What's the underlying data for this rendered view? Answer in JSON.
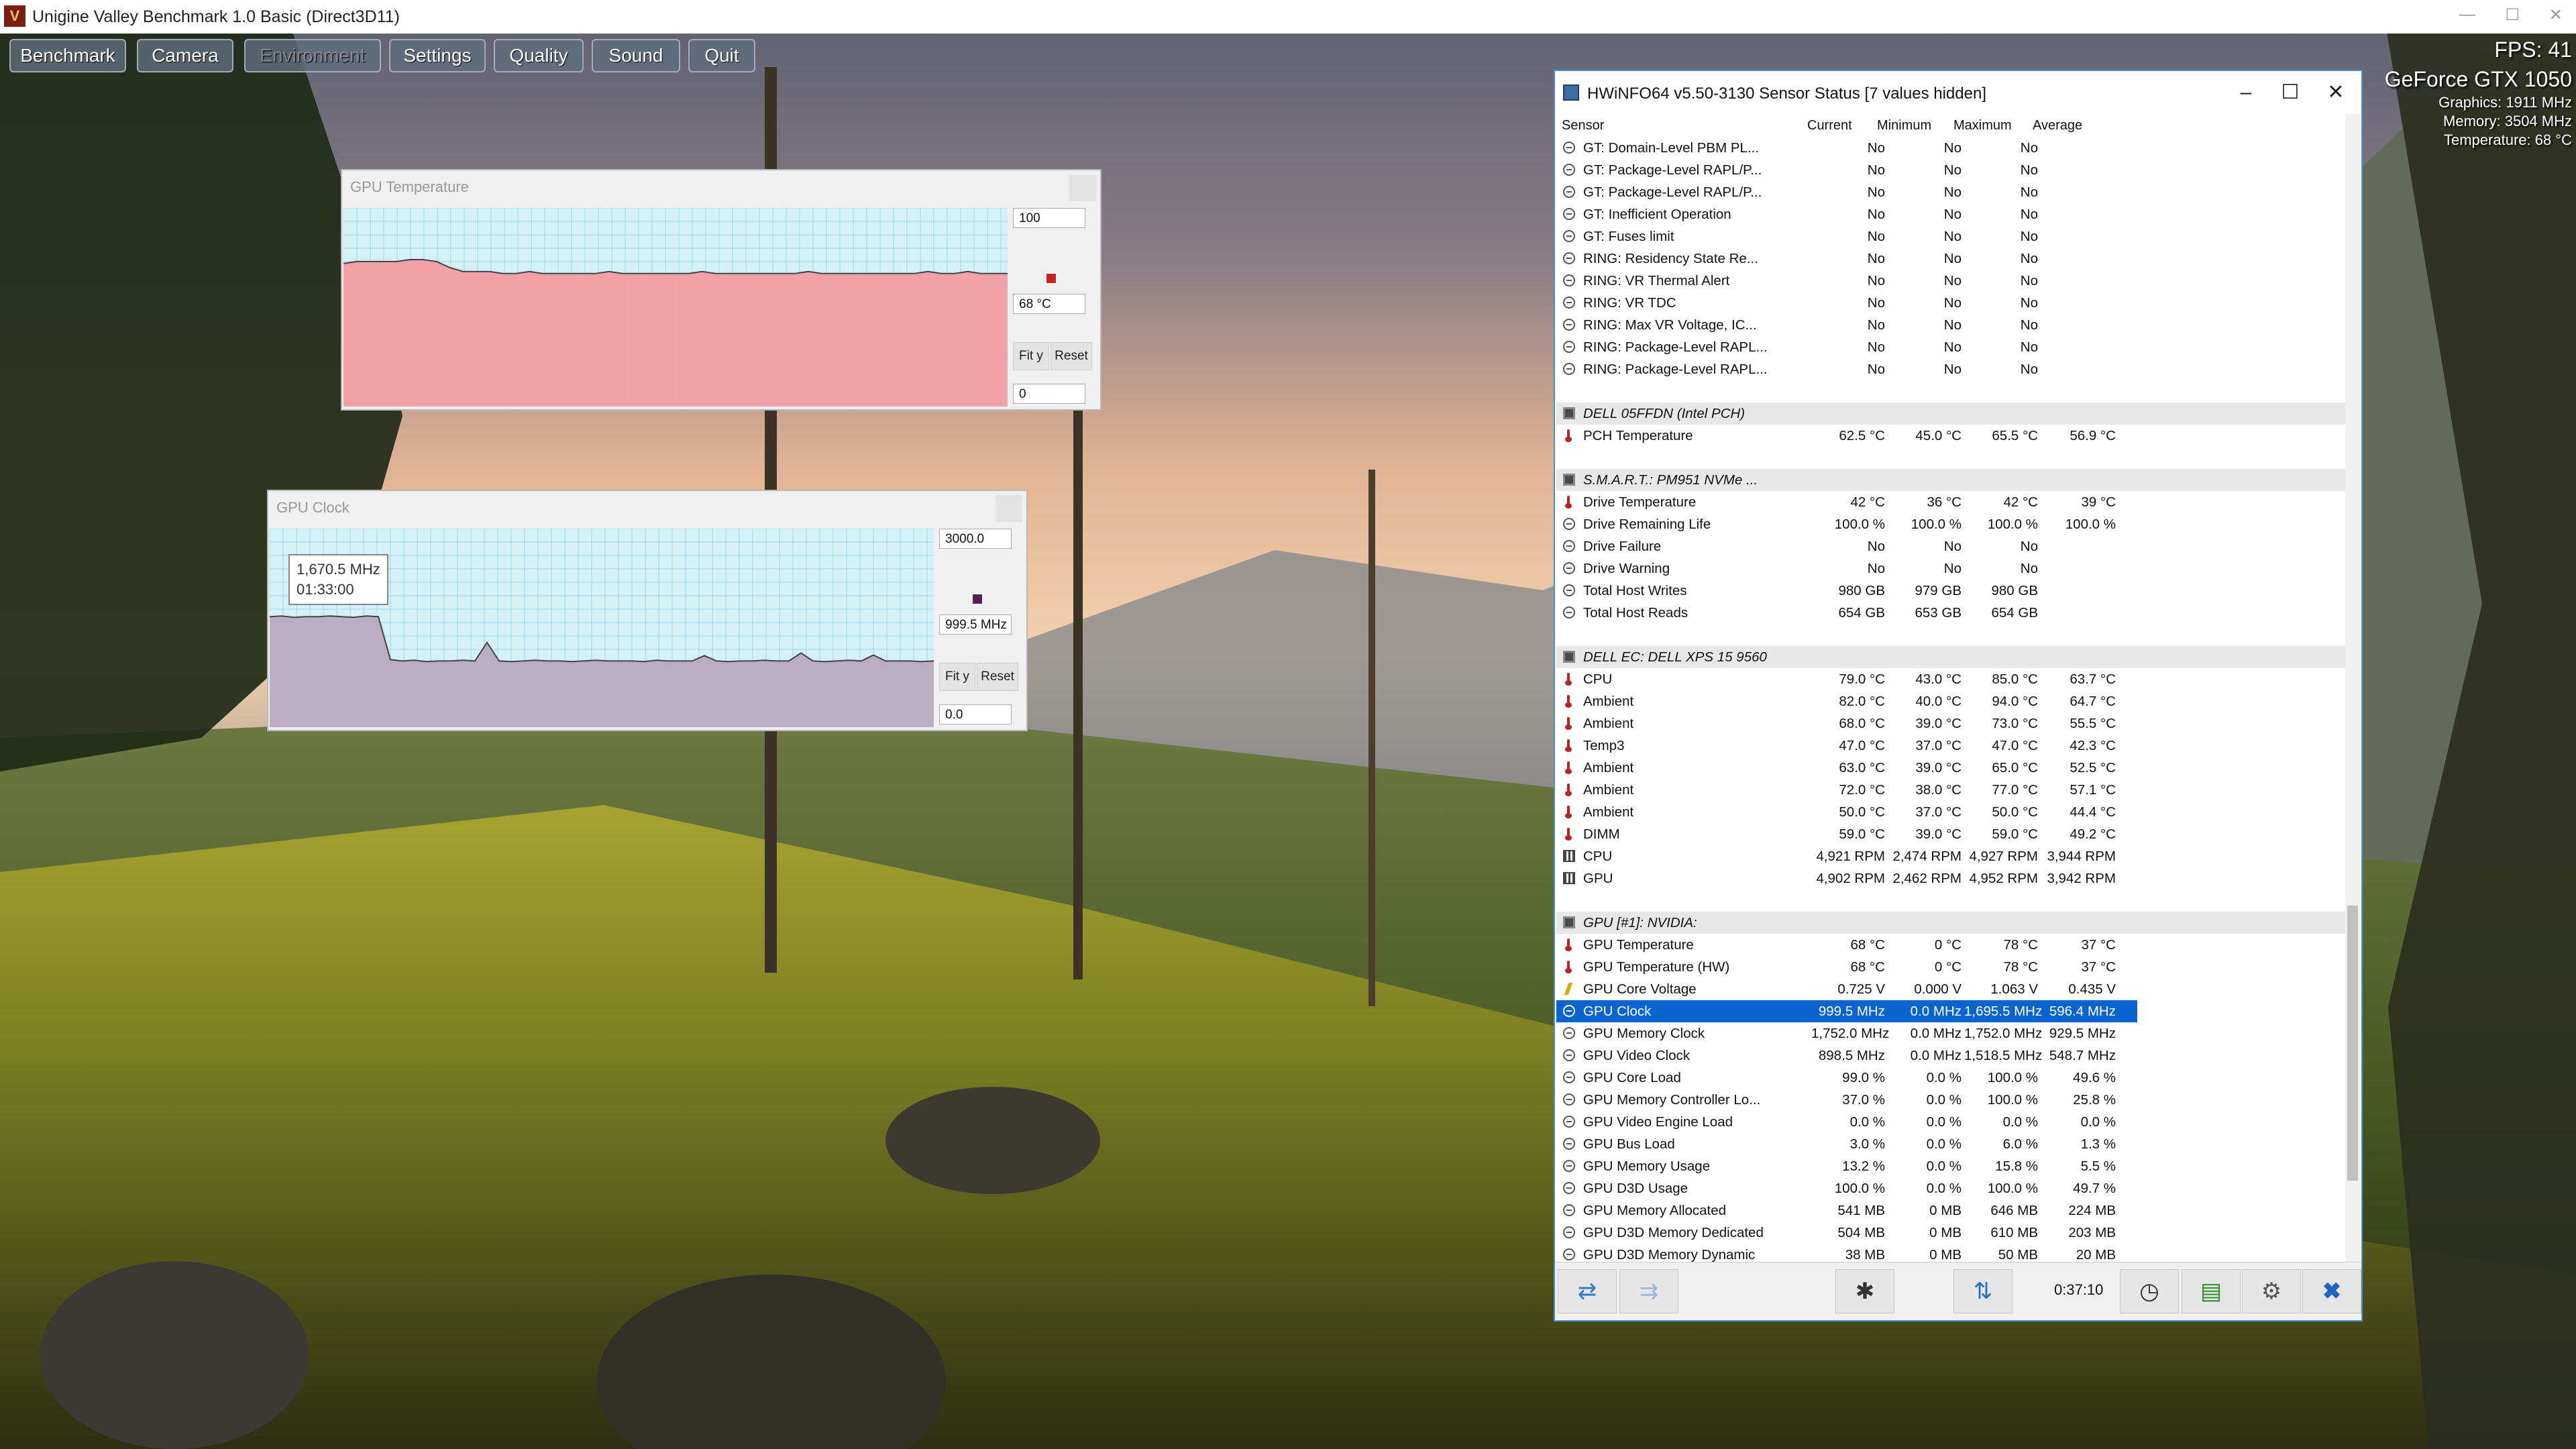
{
  "app": {
    "title": "Unigine Valley Benchmark 1.0 Basic (Direct3D11)",
    "menu": [
      {
        "label": "Benchmark",
        "disabled": false
      },
      {
        "label": "Camera",
        "disabled": false
      },
      {
        "label": "Environment",
        "disabled": true
      },
      {
        "label": "Settings",
        "disabled": false
      },
      {
        "label": "Quality",
        "disabled": false
      },
      {
        "label": "Sound",
        "disabled": false
      },
      {
        "label": "Quit",
        "disabled": false
      }
    ],
    "overlay": {
      "fps": "FPS: 41",
      "gpu": "GeForce GTX 1050",
      "graphics": "Graphics: 1911 MHz",
      "memory": "Memory: 3504 MHz",
      "temperature": "Temperature: 68 °C"
    }
  },
  "temp_graph": {
    "title": "GPU Temperature",
    "max": "100",
    "current": "68 °C",
    "min": "0",
    "fit_label": "Fit y",
    "reset_label": "Reset",
    "color": "#f49aa0",
    "range": [
      0,
      100
    ],
    "values": [
      72,
      73,
      73,
      73,
      73,
      74,
      74,
      73,
      70,
      68,
      68,
      68,
      67,
      67,
      68,
      67,
      67,
      67,
      67,
      67,
      68,
      67,
      67,
      67,
      67,
      67,
      67,
      68,
      67,
      67,
      67,
      67,
      67,
      67,
      67,
      68,
      67,
      67,
      67,
      67,
      67,
      67,
      67,
      67,
      68,
      67,
      67,
      68,
      67,
      67,
      67
    ]
  },
  "clock_graph": {
    "title": "GPU Clock",
    "max": "3000.0",
    "current": "999.5 MHz",
    "min": "0.0",
    "fit_label": "Fit y",
    "reset_label": "Reset",
    "color": "#b7a9bc",
    "range": [
      0,
      3000
    ],
    "tooltip_value": "1,670.5 MHz",
    "tooltip_time": "01:33:00",
    "values": [
      1670,
      1680,
      1660,
      1670,
      1670,
      1680,
      1670,
      1660,
      1680,
      1670,
      1020,
      1000,
      1010,
      990,
      1000,
      1000,
      1010,
      1000,
      1280,
      1000,
      990,
      1000,
      1010,
      1000,
      1000,
      990,
      1000,
      1010,
      1000,
      1000,
      1000,
      990,
      1010,
      1000,
      1000,
      1000,
      1080,
      1000,
      990,
      1000,
      1000,
      1010,
      1000,
      1000,
      1120,
      1000,
      990,
      1000,
      1010,
      1000,
      1090,
      1000,
      1000,
      1000,
      990,
      1000
    ]
  },
  "hwinfo": {
    "title": "HWiNFO64 v5.50-3130 Sensor Status [7 values hidden]",
    "columns": [
      "Sensor",
      "Current",
      "Minimum",
      "Maximum",
      "Average"
    ],
    "rows": [
      {
        "icon": "clock",
        "name": "GT: Domain-Level PBM PL...",
        "cur": "No",
        "min": "No",
        "max": "No",
        "avg": ""
      },
      {
        "icon": "clock",
        "name": "GT: Package-Level RAPL/P...",
        "cur": "No",
        "min": "No",
        "max": "No",
        "avg": ""
      },
      {
        "icon": "clock",
        "name": "GT: Package-Level RAPL/P...",
        "cur": "No",
        "min": "No",
        "max": "No",
        "avg": ""
      },
      {
        "icon": "clock",
        "name": "GT: Inefficient Operation",
        "cur": "No",
        "min": "No",
        "max": "No",
        "avg": ""
      },
      {
        "icon": "clock",
        "name": "GT: Fuses limit",
        "cur": "No",
        "min": "No",
        "max": "No",
        "avg": ""
      },
      {
        "icon": "clock",
        "name": "RING: Residency State Re...",
        "cur": "No",
        "min": "No",
        "max": "No",
        "avg": ""
      },
      {
        "icon": "clock",
        "name": "RING: VR Thermal Alert",
        "cur": "No",
        "min": "No",
        "max": "No",
        "avg": ""
      },
      {
        "icon": "clock",
        "name": "RING: VR TDC",
        "cur": "No",
        "min": "No",
        "max": "No",
        "avg": ""
      },
      {
        "icon": "clock",
        "name": "RING: Max VR Voltage, IC...",
        "cur": "No",
        "min": "No",
        "max": "No",
        "avg": ""
      },
      {
        "icon": "clock",
        "name": "RING: Package-Level RAPL...",
        "cur": "No",
        "min": "No",
        "max": "No",
        "avg": ""
      },
      {
        "icon": "clock",
        "name": "RING: Package-Level RAPL...",
        "cur": "No",
        "min": "No",
        "max": "No",
        "avg": ""
      },
      {
        "type": "blank"
      },
      {
        "type": "group",
        "name": "DELL 05FFDN (Intel PCH)"
      },
      {
        "icon": "therm",
        "name": "PCH Temperature",
        "cur": "62.5 °C",
        "min": "45.0 °C",
        "max": "65.5 °C",
        "avg": "56.9 °C"
      },
      {
        "type": "blank"
      },
      {
        "type": "group",
        "name": "S.M.A.R.T.: PM951 NVMe ..."
      },
      {
        "icon": "therm",
        "name": "Drive Temperature",
        "cur": "42 °C",
        "min": "36 °C",
        "max": "42 °C",
        "avg": "39 °C"
      },
      {
        "icon": "clock",
        "name": "Drive Remaining Life",
        "cur": "100.0 %",
        "min": "100.0 %",
        "max": "100.0 %",
        "avg": "100.0 %"
      },
      {
        "icon": "clock",
        "name": "Drive Failure",
        "cur": "No",
        "min": "No",
        "max": "No",
        "avg": ""
      },
      {
        "icon": "clock",
        "name": "Drive Warning",
        "cur": "No",
        "min": "No",
        "max": "No",
        "avg": ""
      },
      {
        "icon": "clock",
        "name": "Total Host Writes",
        "cur": "980 GB",
        "min": "979 GB",
        "max": "980 GB",
        "avg": ""
      },
      {
        "icon": "clock",
        "name": "Total Host Reads",
        "cur": "654 GB",
        "min": "653 GB",
        "max": "654 GB",
        "avg": ""
      },
      {
        "type": "blank"
      },
      {
        "type": "group",
        "name": "DELL EC: DELL XPS 15 9560"
      },
      {
        "icon": "therm",
        "name": "CPU",
        "cur": "79.0 °C",
        "min": "43.0 °C",
        "max": "85.0 °C",
        "avg": "63.7 °C"
      },
      {
        "icon": "therm",
        "name": "Ambient",
        "cur": "82.0 °C",
        "min": "40.0 °C",
        "max": "94.0 °C",
        "avg": "64.7 °C"
      },
      {
        "icon": "therm",
        "name": "Ambient",
        "cur": "68.0 °C",
        "min": "39.0 °C",
        "max": "73.0 °C",
        "avg": "55.5 °C"
      },
      {
        "icon": "therm",
        "name": "Temp3",
        "cur": "47.0 °C",
        "min": "37.0 °C",
        "max": "47.0 °C",
        "avg": "42.3 °C"
      },
      {
        "icon": "therm",
        "name": "Ambient",
        "cur": "63.0 °C",
        "min": "39.0 °C",
        "max": "65.0 °C",
        "avg": "52.5 °C"
      },
      {
        "icon": "therm",
        "name": "Ambient",
        "cur": "72.0 °C",
        "min": "38.0 °C",
        "max": "77.0 °C",
        "avg": "57.1 °C"
      },
      {
        "icon": "therm",
        "name": "Ambient",
        "cur": "50.0 °C",
        "min": "37.0 °C",
        "max": "50.0 °C",
        "avg": "44.4 °C"
      },
      {
        "icon": "therm",
        "name": "DIMM",
        "cur": "59.0 °C",
        "min": "39.0 °C",
        "max": "59.0 °C",
        "avg": "49.2 °C"
      },
      {
        "icon": "fan",
        "name": "CPU",
        "cur": "4,921 RPM",
        "min": "2,474 RPM",
        "max": "4,927 RPM",
        "avg": "3,944 RPM"
      },
      {
        "icon": "fan",
        "name": "GPU",
        "cur": "4,902 RPM",
        "min": "2,462 RPM",
        "max": "4,952 RPM",
        "avg": "3,942 RPM"
      },
      {
        "type": "blank"
      },
      {
        "type": "group",
        "name": "GPU [#1]: NVIDIA:"
      },
      {
        "icon": "therm",
        "name": "GPU Temperature",
        "cur": "68 °C",
        "min": "0 °C",
        "max": "78 °C",
        "avg": "37 °C"
      },
      {
        "icon": "therm",
        "name": "GPU Temperature (HW)",
        "cur": "68 °C",
        "min": "0 °C",
        "max": "78 °C",
        "avg": "37 °C"
      },
      {
        "icon": "volt",
        "name": "GPU Core Voltage",
        "cur": "0.725 V",
        "min": "0.000 V",
        "max": "1.063 V",
        "avg": "0.435 V"
      },
      {
        "icon": "clock",
        "name": "GPU Clock",
        "cur": "999.5 MHz",
        "min": "0.0 MHz",
        "max": "1,695.5 MHz",
        "avg": "596.4 MHz",
        "selected": true
      },
      {
        "icon": "clock",
        "name": "GPU Memory Clock",
        "cur": "1,752.0 MHz",
        "min": "0.0 MHz",
        "max": "1,752.0 MHz",
        "avg": "929.5 MHz"
      },
      {
        "icon": "clock",
        "name": "GPU Video Clock",
        "cur": "898.5 MHz",
        "min": "0.0 MHz",
        "max": "1,518.5 MHz",
        "avg": "548.7 MHz"
      },
      {
        "icon": "clock",
        "name": "GPU Core Load",
        "cur": "99.0 %",
        "min": "0.0 %",
        "max": "100.0 %",
        "avg": "49.6 %"
      },
      {
        "icon": "clock",
        "name": "GPU Memory Controller Lo...",
        "cur": "37.0 %",
        "min": "0.0 %",
        "max": "100.0 %",
        "avg": "25.8 %"
      },
      {
        "icon": "clock",
        "name": "GPU Video Engine Load",
        "cur": "0.0 %",
        "min": "0.0 %",
        "max": "0.0 %",
        "avg": "0.0 %"
      },
      {
        "icon": "clock",
        "name": "GPU Bus Load",
        "cur": "3.0 %",
        "min": "0.0 %",
        "max": "6.0 %",
        "avg": "1.3 %"
      },
      {
        "icon": "clock",
        "name": "GPU Memory Usage",
        "cur": "13.2 %",
        "min": "0.0 %",
        "max": "15.8 %",
        "avg": "5.5 %"
      },
      {
        "icon": "clock",
        "name": "GPU D3D Usage",
        "cur": "100.0 %",
        "min": "0.0 %",
        "max": "100.0 %",
        "avg": "49.7 %"
      },
      {
        "icon": "clock",
        "name": "GPU Memory Allocated",
        "cur": "541 MB",
        "min": "0 MB",
        "max": "646 MB",
        "avg": "224 MB"
      },
      {
        "icon": "clock",
        "name": "GPU D3D Memory Dedicated",
        "cur": "504 MB",
        "min": "0 MB",
        "max": "610 MB",
        "avg": "203 MB"
      },
      {
        "icon": "clock",
        "name": "GPU D3D Memory Dynamic",
        "cur": "38 MB",
        "min": "0 MB",
        "max": "50 MB",
        "avg": "20 MB"
      }
    ],
    "timer": "0:37:10",
    "toolbar_icons": [
      "nav-arrows-icon",
      "nav-forward-icon",
      "fan-settings-icon",
      "network-icon",
      "clock-icon",
      "report-icon",
      "settings-gear-icon",
      "close-x-icon"
    ]
  },
  "colors": {
    "accent": "#0a64d0",
    "temp_fill": "#f49aa0",
    "clock_fill": "#b7a9bc",
    "plot_bg": "#d4f2f6"
  }
}
